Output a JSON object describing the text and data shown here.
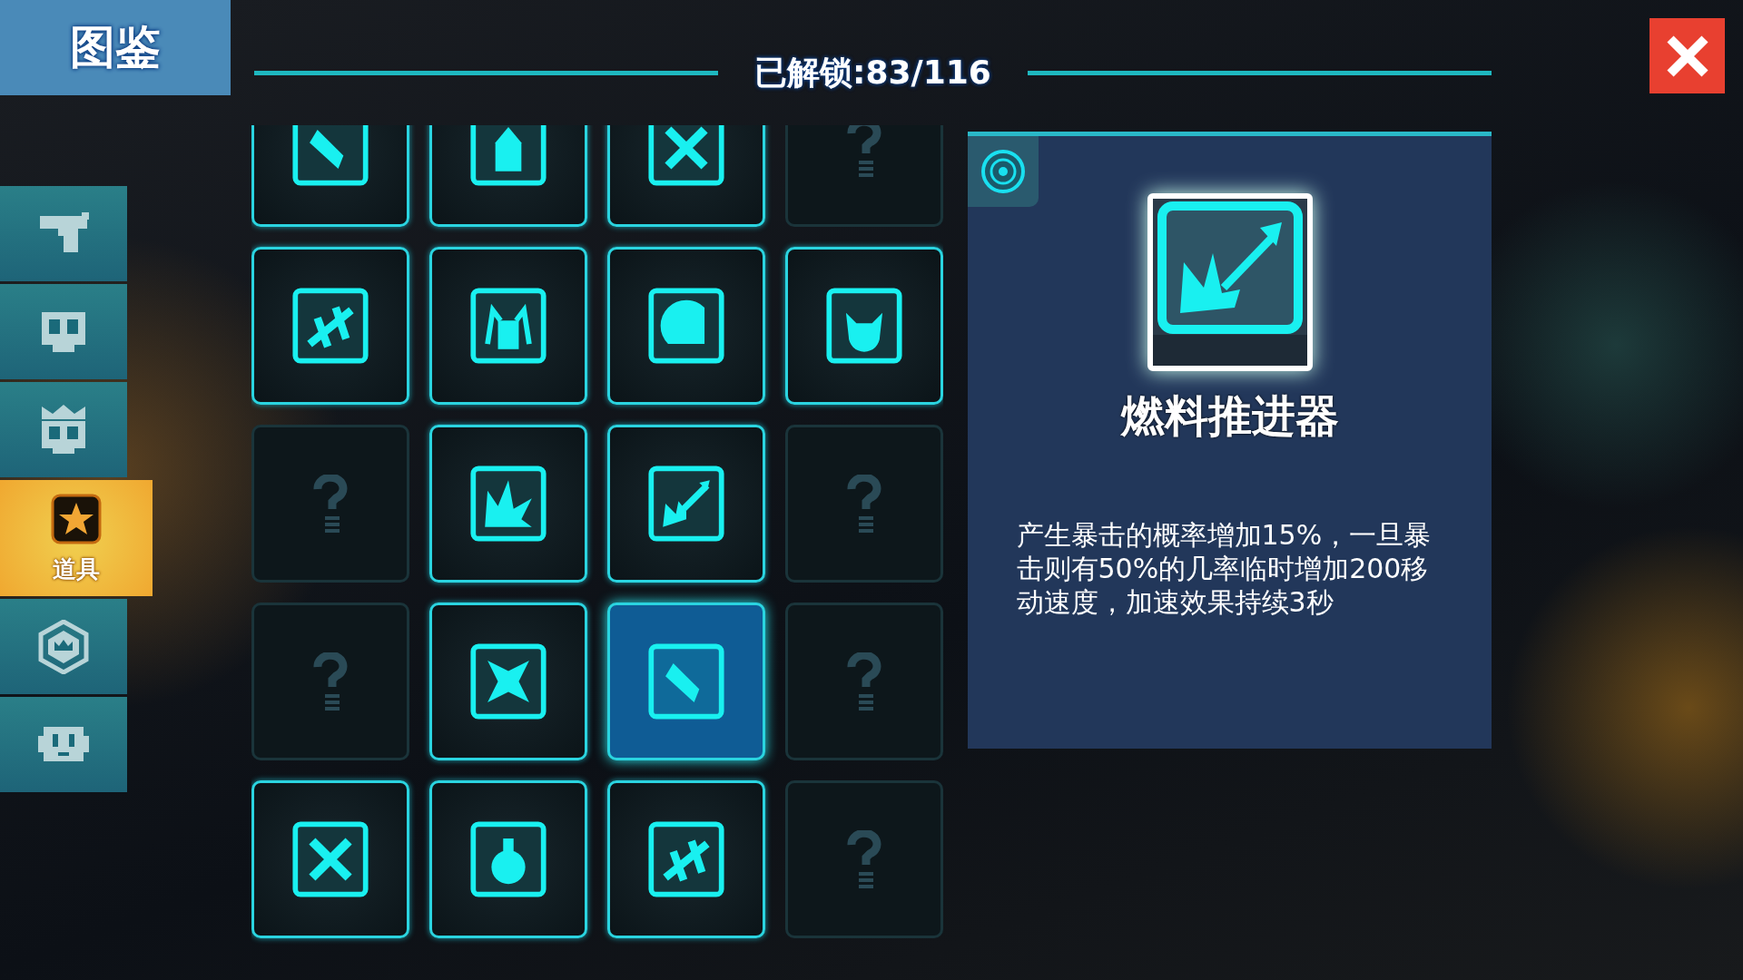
{
  "title": "图鉴",
  "sidebar": {
    "items": [
      {
        "kind": "pistol",
        "selected": false
      },
      {
        "kind": "skull",
        "selected": false
      },
      {
        "kind": "crowned-skull",
        "selected": false
      },
      {
        "kind": "star",
        "label": "道具",
        "selected": true
      },
      {
        "kind": "crown-hexagon",
        "selected": false
      },
      {
        "kind": "robot",
        "selected": false
      }
    ]
  },
  "unlocked_count": "已解锁:83/116",
  "grid": {
    "cells": [
      {
        "locked": false,
        "selected": false
      },
      {
        "locked": false,
        "selected": false
      },
      {
        "locked": false,
        "selected": false
      },
      {
        "locked": true,
        "selected": false
      },
      {
        "locked": false,
        "selected": false
      },
      {
        "locked": false,
        "selected": false
      },
      {
        "locked": false,
        "selected": false
      },
      {
        "locked": false,
        "selected": false
      },
      {
        "locked": true,
        "selected": false
      },
      {
        "locked": false,
        "selected": false
      },
      {
        "locked": false,
        "selected": false
      },
      {
        "locked": true,
        "selected": false
      },
      {
        "locked": true,
        "selected": false
      },
      {
        "locked": false,
        "selected": false
      },
      {
        "locked": false,
        "selected": true
      },
      {
        "locked": true,
        "selected": false
      },
      {
        "locked": false,
        "selected": false
      },
      {
        "locked": false,
        "selected": false
      },
      {
        "locked": false,
        "selected": false
      },
      {
        "locked": true,
        "selected": false
      }
    ]
  },
  "detail": {
    "name": "燃料推进器",
    "description": "产生暴击的概率增加15%，一旦暴击则有50%的几率临时增加200移动速度，加速效果持续3秒"
  }
}
